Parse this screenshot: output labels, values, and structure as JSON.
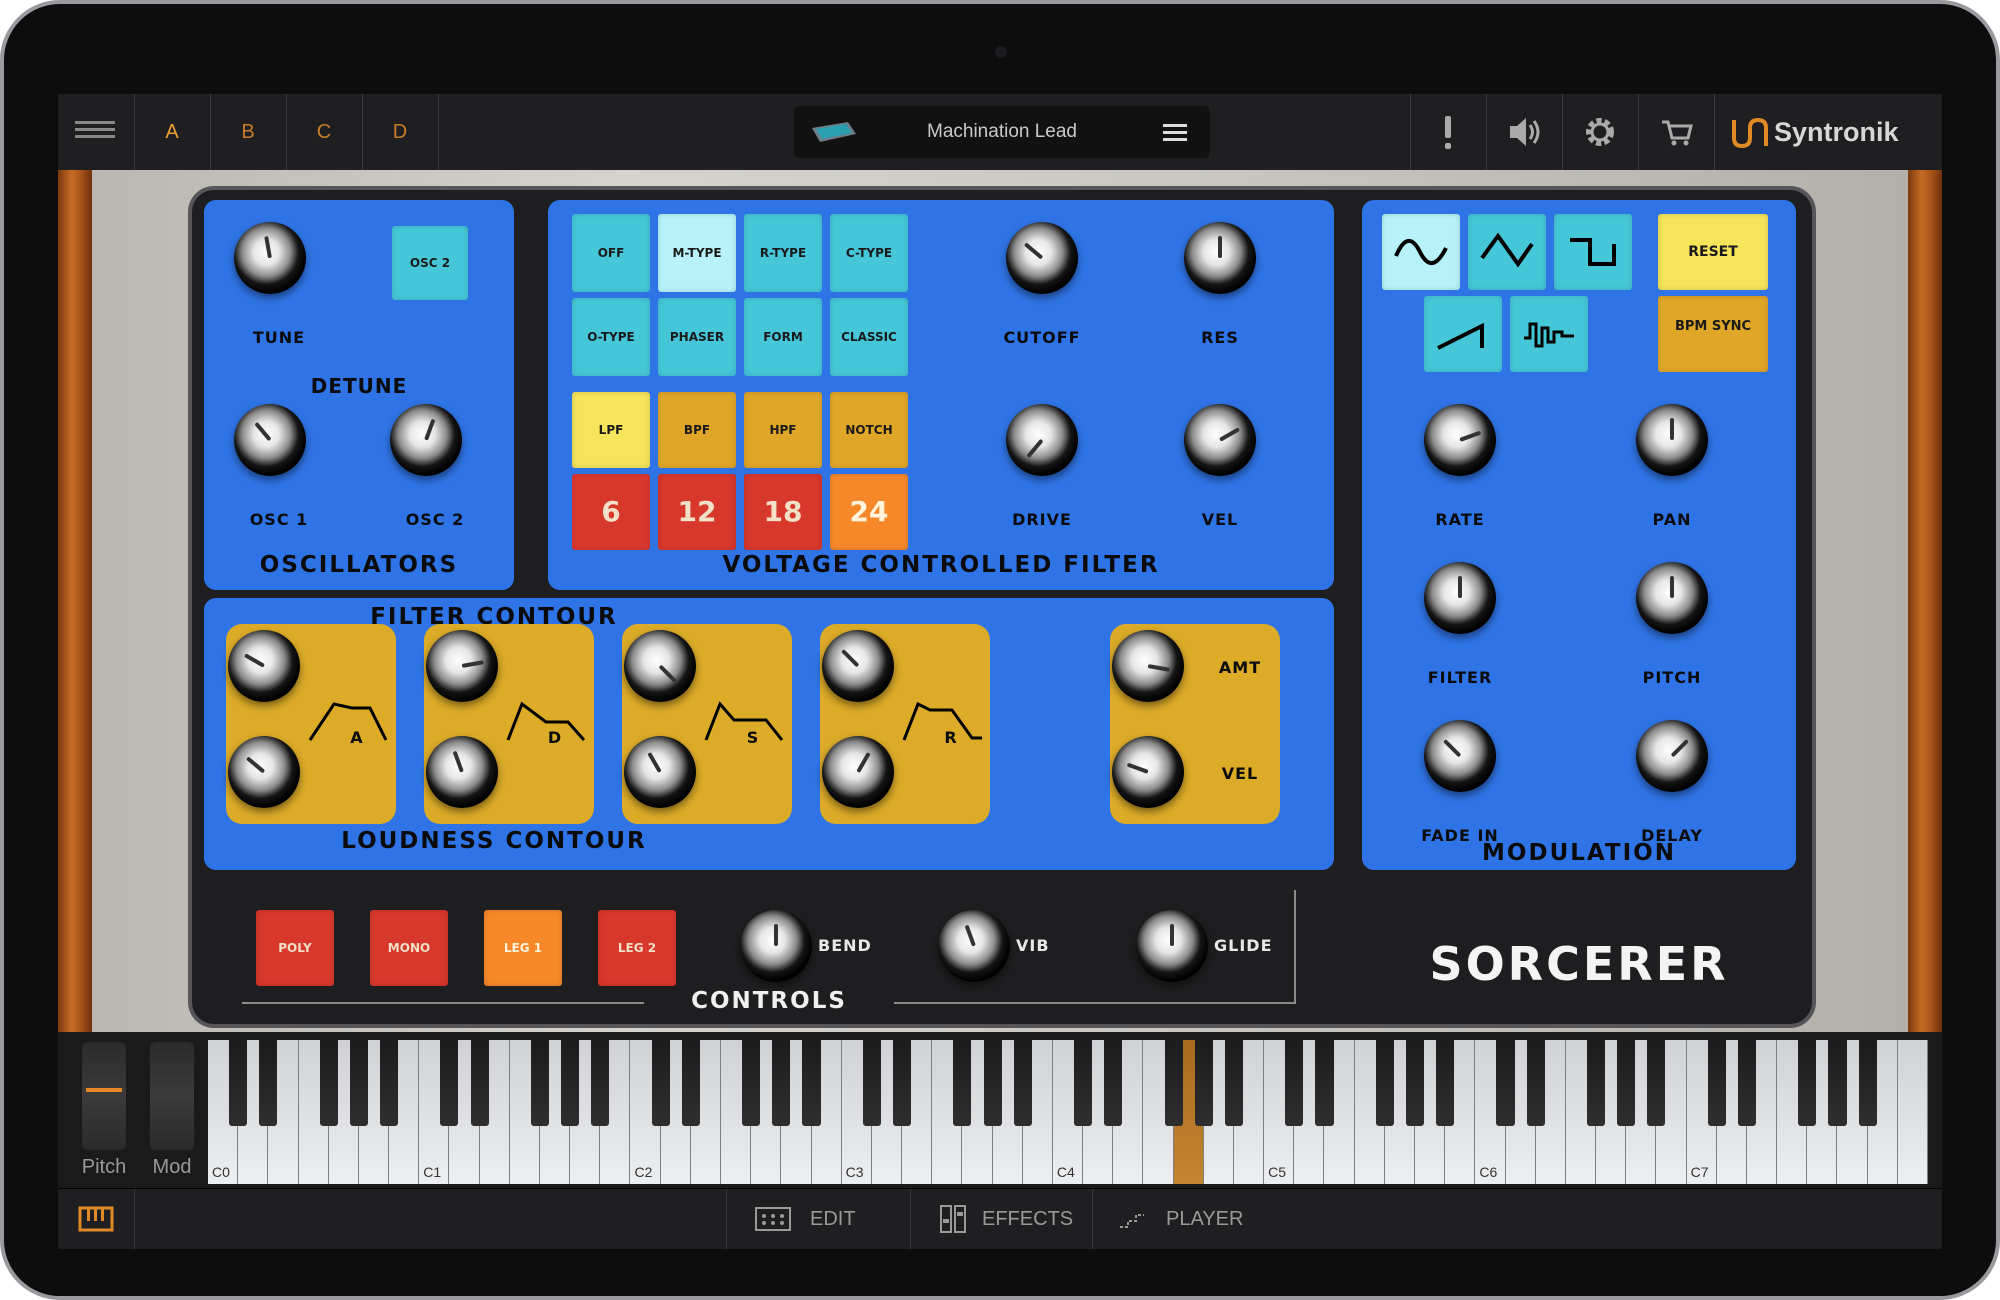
{
  "topbar": {
    "menu_icon": "hamburger-icon",
    "sets": [
      "A",
      "B",
      "C",
      "D"
    ],
    "preset_name": "Machination Lead",
    "brand": "Syntronik",
    "icons": [
      "alert-icon",
      "speaker-icon",
      "gear-icon",
      "cart-icon"
    ]
  },
  "oscillators": {
    "title": "OSCILLATORS",
    "tune_label": "TUNE",
    "osc2_button": "OSC 2",
    "detune_label": "DETUNE",
    "osc1_label": "OSC 1",
    "osc2_label": "OSC 2"
  },
  "vcf": {
    "title": "VOLTAGE CONTROLLED FILTER",
    "type_buttons": [
      "OFF",
      "M-TYPE",
      "R-TYPE",
      "C-TYPE",
      "O-TYPE",
      "PHASER",
      "FORM",
      "CLASSIC"
    ],
    "mode_buttons": [
      "LPF",
      "BPF",
      "HPF",
      "NOTCH"
    ],
    "slope_buttons": [
      "6",
      "12",
      "18",
      "24"
    ],
    "knobs": [
      "CUTOFF",
      "RES",
      "DRIVE",
      "VEL"
    ]
  },
  "filter_contour": {
    "title": "FILTER CONTOUR",
    "stages": [
      "A",
      "D",
      "S",
      "R"
    ],
    "amt_label": "AMT",
    "vel_label": "VEL"
  },
  "loudness_contour": {
    "title": "LOUDNESS CONTOUR"
  },
  "modulation": {
    "title": "MODULATION",
    "wave_icons": [
      "sine-wave-icon",
      "triangle-wave-icon",
      "square-wave-icon",
      "sawtooth-wave-icon",
      "sample-hold-wave-icon"
    ],
    "reset_button": "RESET",
    "bpm_sync_button": "BPM SYNC",
    "knobs": [
      "RATE",
      "PAN",
      "FILTER",
      "PITCH",
      "FADE IN",
      "DELAY"
    ]
  },
  "controls": {
    "title": "CONTROLS",
    "mode_buttons": [
      "POLY",
      "MONO",
      "LEG 1",
      "LEG 2"
    ],
    "knobs": [
      "BEND",
      "VIB",
      "GLIDE"
    ]
  },
  "synth_name": "SORCERER",
  "keyboard": {
    "wheels": [
      "Pitch",
      "Mod"
    ],
    "octave_labels": [
      "C0",
      "C1",
      "C2",
      "C3",
      "C4",
      "C5",
      "C6",
      "C7"
    ]
  },
  "bottombar": {
    "tabs": [
      "EDIT",
      "EFFECTS",
      "PLAYER"
    ]
  },
  "colors": {
    "panel_blue": "#2f74e6",
    "teal": "#45c7d9",
    "amber": "#e0a628",
    "red": "#d8382c",
    "accent_orange": "#c87c2a"
  }
}
